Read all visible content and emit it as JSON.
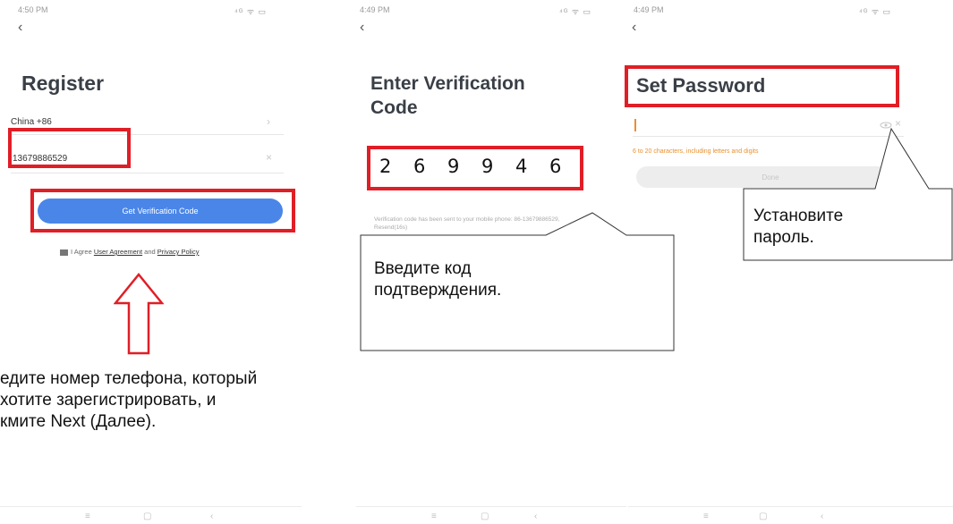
{
  "screen1": {
    "time": "4:50 PM",
    "status_icons": "⁴ᴳ ᯤ ▭",
    "back": "‹",
    "title": "Register",
    "country": "China +86",
    "country_chevron": "›",
    "phone_value": "13679886529",
    "clear": "×",
    "button": "Get Verification Code",
    "agree_prefix": "I Agree",
    "user_agreement": "User Agreement",
    "and": "and",
    "privacy_policy": "Privacy Policy",
    "instruction": "едите номер телефона, который\nхотите зарегистрировать, и\nкмите Next (Далее).",
    "nav": [
      "≡",
      "▢",
      "‹"
    ]
  },
  "screen2": {
    "time": "4:49 PM",
    "status_icons": "⁴ᴳ ᯤ ▭",
    "back": "‹",
    "title": "Enter Verification\nCode",
    "code_digits": [
      "2",
      "6",
      "9",
      "9",
      "4",
      "6"
    ],
    "info": "Verification code has been sent to your mobile phone: 86-13679886529, Resend(16s)",
    "callout": "Введите код\nподтверждения.",
    "nav": [
      "≡",
      "▢",
      "‹"
    ]
  },
  "screen3": {
    "time": "4:49 PM",
    "status_icons": "⁴ᴳ ᯤ ▭",
    "back": "‹",
    "title": "Set Password",
    "hint": "6 to 20 characters, including letters and digits",
    "done": "Done",
    "callout": "Установите\nпароль.",
    "nav": [
      "≡",
      "▢",
      "‹"
    ]
  },
  "colors": {
    "highlight_red": "#e01e26",
    "button_blue": "#4a86e8",
    "hint_orange": "#e8912e",
    "arrow_red": "#e01e26"
  }
}
